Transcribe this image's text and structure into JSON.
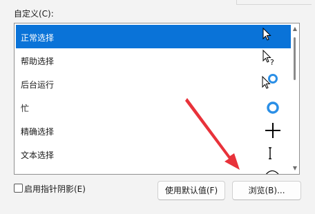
{
  "custom_label": "自定义(C):",
  "cursor_list": {
    "items": [
      {
        "label": "正常选择",
        "icon": "arrow-pointer-icon",
        "selected": true
      },
      {
        "label": "帮助选择",
        "icon": "help-pointer-icon",
        "selected": false
      },
      {
        "label": "后台运行",
        "icon": "working-in-background-icon",
        "selected": false
      },
      {
        "label": "忙",
        "icon": "busy-ring-icon",
        "selected": false
      },
      {
        "label": "精确选择",
        "icon": "precision-crosshair-icon",
        "selected": false
      },
      {
        "label": "文本选择",
        "icon": "text-beam-icon",
        "selected": false
      },
      {
        "label": "",
        "icon": "handwriting-pen-icon",
        "selected": false
      }
    ]
  },
  "shadow_checkbox": {
    "label": "启用指针阴影(E)",
    "checked": false
  },
  "buttons": {
    "use_default": "使用默认值(F)",
    "browse": "浏览(B)..."
  },
  "colors": {
    "selection": "#0a73d8",
    "busy_ring": "#2b8fe6",
    "annotation_arrow": "#e8323a"
  }
}
